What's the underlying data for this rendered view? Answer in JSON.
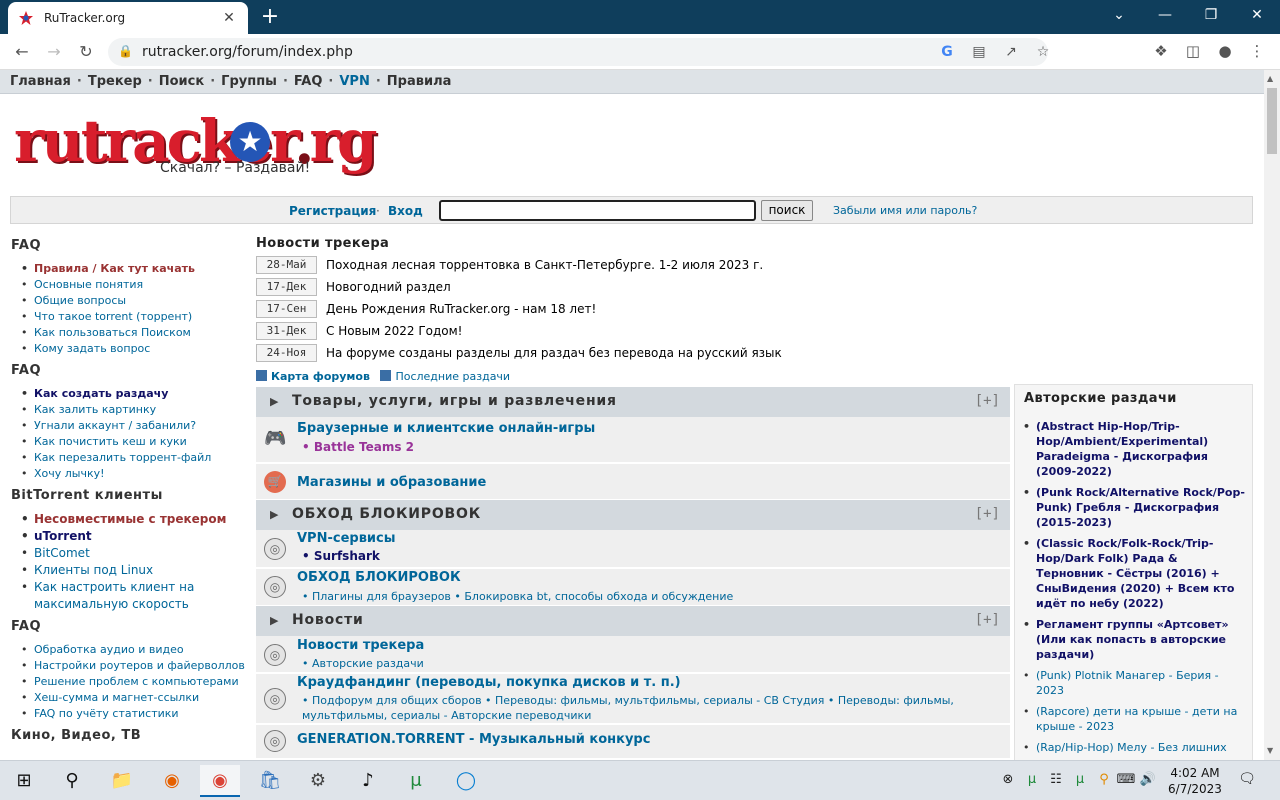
{
  "browser": {
    "tab_title": "RuTracker.org",
    "url": "rutracker.org/forum/index.php",
    "new_tab": "+",
    "tab_close": "✕",
    "min_glyph": "⌄",
    "minimize": "—",
    "restore": "❐",
    "close": "✕"
  },
  "topnav": {
    "items": [
      "Главная",
      "Трекер",
      "Поиск",
      "Группы",
      "FAQ",
      "VPN",
      "Правила"
    ],
    "sep": "·"
  },
  "logo": {
    "text": "rutracker org",
    "slogan": "Скачал? – Раздавай!"
  },
  "loginbar": {
    "register": "Регистрация",
    "sep": "·",
    "login": "Вход",
    "search_value": "",
    "search_button": "поиск",
    "forgot": "Забыли имя или пароль?"
  },
  "sidebar": {
    "sections": [
      {
        "title": "FAQ",
        "items": [
          {
            "text": "Правила / Как тут качать",
            "style": "red"
          },
          {
            "text": "Основные понятия"
          },
          {
            "text": "Общие вопросы"
          },
          {
            "text": "Что такое torrent (торрент)"
          },
          {
            "text": "Как пользоваться Поиском"
          },
          {
            "text": "Кому задать вопрос"
          }
        ]
      },
      {
        "title": "FAQ",
        "items": [
          {
            "text": "Как создать раздачу",
            "style": "dark"
          },
          {
            "text": "Как залить картинку"
          },
          {
            "text": "Угнали аккаунт / забанили?"
          },
          {
            "text": "Как почистить кеш и куки"
          },
          {
            "text": "Как перезалить торрент-файл"
          },
          {
            "text": "Хочу лычку!"
          }
        ]
      },
      {
        "title": "BitTorrent клиенты",
        "items": [
          {
            "text": "Несовместимые с трекером",
            "style": "red big"
          },
          {
            "text": "uTorrent",
            "style": "dark big"
          },
          {
            "text": "BitComet",
            "style": "big"
          },
          {
            "text": "Клиенты под Linux",
            "style": "big"
          },
          {
            "text": "Как настроить клиент на максимальную скорость",
            "style": "big"
          }
        ]
      },
      {
        "title": "FAQ",
        "items": [
          {
            "text": "Обработка аудио и видео"
          },
          {
            "text": "Настройки роутеров и файерволлов"
          },
          {
            "text": "Решение проблем с компьютерами"
          },
          {
            "text": "Хеш-сумма и магнет-ссылки"
          },
          {
            "text": "FAQ по учёту статистики"
          }
        ]
      },
      {
        "title": "Кино, Видео, ТВ",
        "items": []
      }
    ]
  },
  "news": {
    "title": "Новости трекера",
    "items": [
      {
        "date": "28-Май",
        "text": "Походная лесная торрентовка в Санкт-Петербурге. 1-2 июля 2023 г."
      },
      {
        "date": "17-Дек",
        "text": "Новогодний раздел"
      },
      {
        "date": "17-Сен",
        "text": "День Рождения RuTracker.org - нам 18 лет!"
      },
      {
        "date": "31-Дек",
        "text": "С Новым 2022 Годом!"
      },
      {
        "date": "24-Ноя",
        "text": "На форуме созданы разделы для раздач без перевода на русский язык"
      }
    ]
  },
  "links": {
    "forum_map": "Карта форумов",
    "latest": "Последние раздачи"
  },
  "categories": [
    {
      "name": "Товары, услуги, игры и развлечения",
      "toggle": "[+]",
      "forums": [
        {
          "name": "Браузерные и клиентские онлайн-игры",
          "sub": "• Battle Teams 2",
          "icon": "🎮"
        },
        {
          "name": "Магазины и образование",
          "sub": "",
          "icon": "🛒"
        }
      ]
    },
    {
      "name": "ОБХОД БЛОКИРОВОК",
      "toggle": "[+]",
      "forums": [
        {
          "name": "VPN-сервисы",
          "sub": "• Surfshark",
          "icon": "◎"
        },
        {
          "name": "ОБХОД БЛОКИРОВОК",
          "sub": "• Плагины для браузеров • Блокировка bt, способы обхода и обсуждение",
          "icon": "◎"
        }
      ]
    },
    {
      "name": "Новости",
      "toggle": "[+]",
      "forums": [
        {
          "name": "Новости трекера",
          "sub": "• Авторские раздачи",
          "icon": "◎"
        },
        {
          "name": "Краудфандинг (переводы, покупка дисков и т. п.)",
          "sub": "• Подфорум для общих сборов • Переводы: фильмы, мультфильмы, сериалы - СВ Студия • Переводы: фильмы, мультфильмы, сериалы - Авторские переводчики",
          "icon": "◎"
        },
        {
          "name": "GENERATION.TORRENT - Музыкальный конкурс",
          "sub": "",
          "icon": "◎"
        }
      ]
    }
  ],
  "author_releases": {
    "title": "Авторские раздачи",
    "items": [
      {
        "text": "(Abstract Hip-Hop/Trip-Hop/Ambient/Experimental) Paradeigma - Дискография (2009-2022)",
        "bold": true
      },
      {
        "text": "(Punk Rock/Alternative Rock/Pop-Punk) Гребля - Дискография (2015-2023)",
        "bold": true
      },
      {
        "text": "(Classic Rock/Folk-Rock/Trip-Hop/Dark Folk) Рада & Терновник - Сёстры (2016) + СныВидения (2020) + Всем кто идёт по небу (2022)",
        "bold": true
      },
      {
        "text": "Регламент группы «Артсовет» (Или как попасть в авторские раздачи)",
        "bold": true
      },
      {
        "text": "(Punk) Plotnik Манагер - Берия - 2023",
        "bold": false
      },
      {
        "text": "(Rapcore) дети на крыше - дети на крыше - 2023",
        "bold": false
      },
      {
        "text": "(Rap/Hip-Hop) Мелу - Без лишних",
        "bold": false
      }
    ]
  },
  "taskbar": {
    "time": "4:02 AM",
    "date": "6/7/2023"
  }
}
